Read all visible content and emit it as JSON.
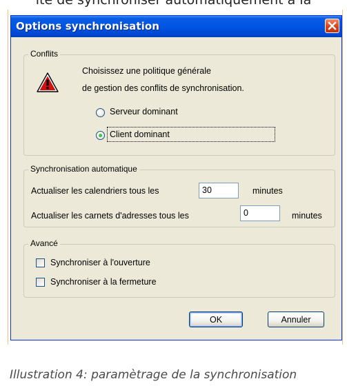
{
  "background": {
    "top_text": "ıte de synchroniser automatiquement à la",
    "caption": "Illustration 4: paramètrage de la synchronisation"
  },
  "dialog": {
    "title": "Options synchronisation",
    "conflicts": {
      "legend": "Conflits",
      "message_line1": "Choisissez une politique générale",
      "message_line2": "de gestion des conflits de synchronisation.",
      "options": [
        "Serveur dominant",
        "Client dominant"
      ],
      "selected": "Client dominant"
    },
    "auto_sync": {
      "legend": "Synchronisation automatique",
      "calendars_label": "Actualiser les calendriers tous les",
      "calendars_value": "30",
      "calendars_unit": "minutes",
      "addressbooks_label": "Actualiser les carnets d'adresses tous les",
      "addressbooks_value": "0",
      "addressbooks_unit": "minutes"
    },
    "advanced": {
      "legend": "Avancé",
      "sync_on_open": "Synchroniser à l'ouverture",
      "sync_on_open_checked": false,
      "sync_on_close": "Synchroniser à la fermeture",
      "sync_on_close_checked": false
    },
    "buttons": {
      "ok": "OK",
      "cancel": "Annuler"
    }
  },
  "icons": {
    "warning": "warning-icon",
    "close": "close-icon"
  },
  "colors": {
    "titlebar": "#0054e3",
    "window_bg": "#ece9d8",
    "close_button": "#d8431a",
    "radio_selected": "#21a121"
  }
}
